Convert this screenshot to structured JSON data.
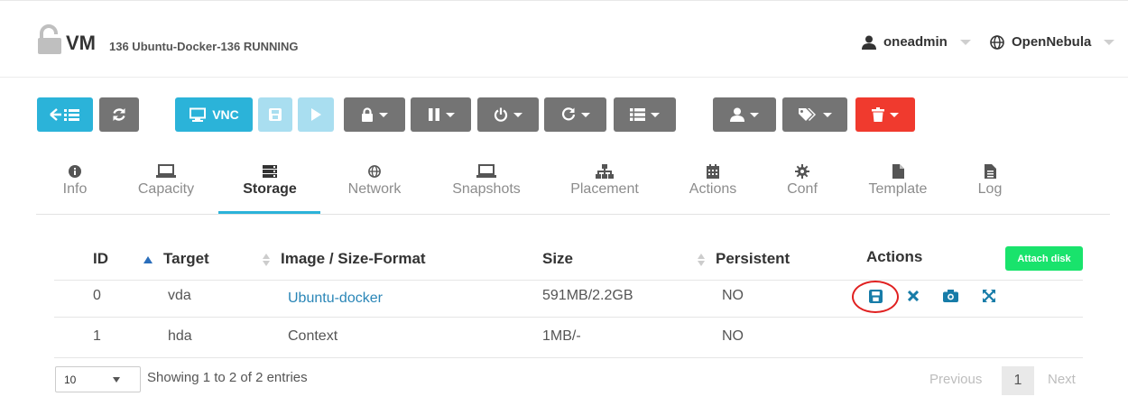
{
  "header": {
    "vm_label": "VM",
    "vm_subtitle": "136 Ubuntu-Docker-136 RUNNING",
    "user": "oneadmin",
    "zone": "OpenNebula"
  },
  "toolbar": {
    "back_icon": "list-back-icon",
    "refresh_icon": "refresh-icon",
    "vnc_label": "VNC",
    "save_icon": "save-icon",
    "play_icon": "play-icon",
    "lock_icon": "lock-icon",
    "pause_icon": "pause-icon",
    "power_icon": "power-icon",
    "reboot_icon": "reboot-icon",
    "list_icon": "list-icon",
    "user_icon": "user-icon",
    "tags_icon": "tags-icon",
    "delete_icon": "trash-icon",
    "colors": {
      "cyan": "#2bb3d9",
      "gray": "#747474",
      "red": "#f03a2e"
    }
  },
  "tabs": [
    {
      "label": "Info",
      "icon": "info-icon"
    },
    {
      "label": "Capacity",
      "icon": "laptop-icon"
    },
    {
      "label": "Storage",
      "icon": "storage-icon",
      "active": true
    },
    {
      "label": "Network",
      "icon": "globe-icon"
    },
    {
      "label": "Snapshots",
      "icon": "laptop-icon"
    },
    {
      "label": "Placement",
      "icon": "sitemap-icon"
    },
    {
      "label": "Actions",
      "icon": "calendar-icon"
    },
    {
      "label": "Conf",
      "icon": "cog-icon"
    },
    {
      "label": "Template",
      "icon": "file-icon"
    },
    {
      "label": "Log",
      "icon": "file-text-icon"
    }
  ],
  "table": {
    "columns": [
      "ID",
      "Target",
      "Image / Size-Format",
      "Size",
      "Persistent",
      "Actions"
    ],
    "attach_label": "Attach disk",
    "rows": [
      {
        "id": "0",
        "target": "vda",
        "image": "Ubuntu-docker",
        "size": "591MB/2.2GB",
        "persistent": "NO",
        "actions": [
          "save-icon",
          "close-icon",
          "camera-icon",
          "resize-icon"
        ]
      },
      {
        "id": "1",
        "target": "hda",
        "image": "Context",
        "size": "1MB/-",
        "persistent": "NO"
      }
    ]
  },
  "footer": {
    "page_size": "10",
    "showing": "Showing 1 to 2 of 2 entries",
    "previous": "Previous",
    "current_page": "1",
    "next": "Next"
  }
}
